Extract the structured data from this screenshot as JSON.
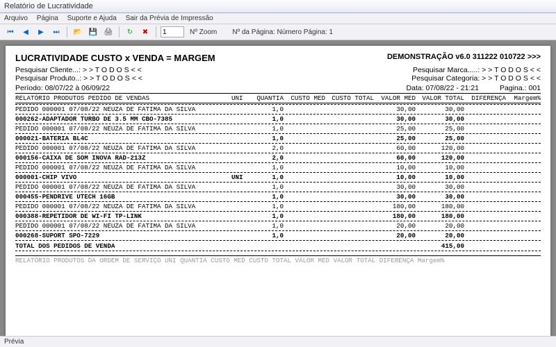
{
  "window": {
    "title": "Relatório de Lucratividade"
  },
  "menu": {
    "arquivo": "Arquivo",
    "pagina": "Página",
    "suporte": "Suporte e Ajuda",
    "sair": "Sair da Prévia de Impressão"
  },
  "toolbar": {
    "zoom_value": "1",
    "zoom_label": "Nº Zoom",
    "page_label": "Nº da Página: Número Página: 1"
  },
  "report": {
    "title_left": "LUCRATIVIDADE CUSTO x VENDA = MARGEM",
    "title_right": "DEMONSTRAÇÃO v6.0 311222 010722 >>>",
    "filters": {
      "cliente": "Pesquisar Cliente...: > >  T O D O S  < <",
      "produto": "Pesquisar Produto..: > >  T O D O S  < <",
      "marca": "Pesquisar Marca.....: > >  T O D O S  < <",
      "categoria": "Pesquisar Categoria: > >  T O D O S  < <"
    },
    "periodo": "Período: 08/07/22 à 06/09/22",
    "data": "Data: 07/08/22 - 21:21",
    "pagina": "Pagina.: 001",
    "colhead": {
      "desc": "RELATÓRIO PRODUTOS PEDIDO DE VENDAS",
      "uni": "UNI",
      "qt": "QUANTIA",
      "cm": "CUSTO MED",
      "ct": "CUSTO TOTAL",
      "vm": "VALOR MED",
      "vt": "VALOR TOTAL",
      "df": "DIFERENÇA",
      "mg": "Margem%"
    },
    "rows": [
      {
        "type": "pedido",
        "desc": "PEDIDO 000001 07/08/22  NEUZA DE FATIMA DA SILVA",
        "qt": "1,0",
        "vm": "30,00",
        "vt": "30,00"
      },
      {
        "type": "produto",
        "desc": "000262-ADAPTADOR TURBO DE 3.5 MM CBO-7385",
        "qt": "1,0",
        "vm": "30,00",
        "vt": "30,00"
      },
      {
        "type": "pedido",
        "desc": "PEDIDO 000001 07/08/22  NEUZA DE FATIMA DA SILVA",
        "qt": "1,0",
        "vm": "25,00",
        "vt": "25,00"
      },
      {
        "type": "produto",
        "desc": "000021-BATERIA BL4C",
        "qt": "1,0",
        "vm": "25,00",
        "vt": "25,00"
      },
      {
        "type": "pedido",
        "desc": "PEDIDO 000001 07/08/22  NEUZA DE FATIMA DA SILVA",
        "qt": "2,0",
        "vm": "60,00",
        "vt": "120,00"
      },
      {
        "type": "produto",
        "desc": "000156-CAIXA DE SOM INOVA RAD-213Z",
        "qt": "2,0",
        "vm": "60,00",
        "vt": "120,00"
      },
      {
        "type": "pedido",
        "desc": "PEDIDO 000001 07/08/22  NEUZA DE FATIMA DA SILVA",
        "qt": "1,0",
        "vm": "10,00",
        "vt": "10,00"
      },
      {
        "type": "produto",
        "desc": "000001-CHIP VIVO",
        "uni": "UNI",
        "qt": "1,0",
        "vm": "10,00",
        "vt": "10,00"
      },
      {
        "type": "pedido",
        "desc": "PEDIDO 000001 07/08/22  NEUZA DE FATIMA DA SILVA",
        "qt": "1,0",
        "vm": "30,00",
        "vt": "30,00"
      },
      {
        "type": "produto",
        "desc": "000455-PENDRIVE UTECH 16GB",
        "qt": "1,0",
        "vm": "30,00",
        "vt": "30,00"
      },
      {
        "type": "pedido",
        "desc": "PEDIDO 000001 07/08/22  NEUZA DE FATIMA DA SILVA",
        "qt": "1,0",
        "vm": "180,00",
        "vt": "180,00"
      },
      {
        "type": "produto",
        "desc": "000388-REPETIDOR DE WI-FI TP-LINK",
        "qt": "1,0",
        "vm": "180,00",
        "vt": "180,00"
      },
      {
        "type": "pedido",
        "desc": "PEDIDO 000001 07/08/22  NEUZA DE FATIMA DA SILVA",
        "qt": "1,0",
        "vm": "20,00",
        "vt": "20,00"
      },
      {
        "type": "produto",
        "desc": "000268-SUPORT SPO-7229",
        "qt": "1,0",
        "vm": "20,00",
        "vt": "20,00"
      }
    ],
    "total_label": "TOTAL DOS PEDIDOS DE VENDA",
    "total_value": "415,00",
    "footer_faded": "RELATÓRIO PRODUTOS DA ORDEM DE SERVIÇO   UNI QUANTIA CUSTO MED  CUSTO TOTAL VALOR MED  VALOR TOTAL DIFERENÇA Margem%"
  },
  "status": {
    "text": "Prévia"
  }
}
